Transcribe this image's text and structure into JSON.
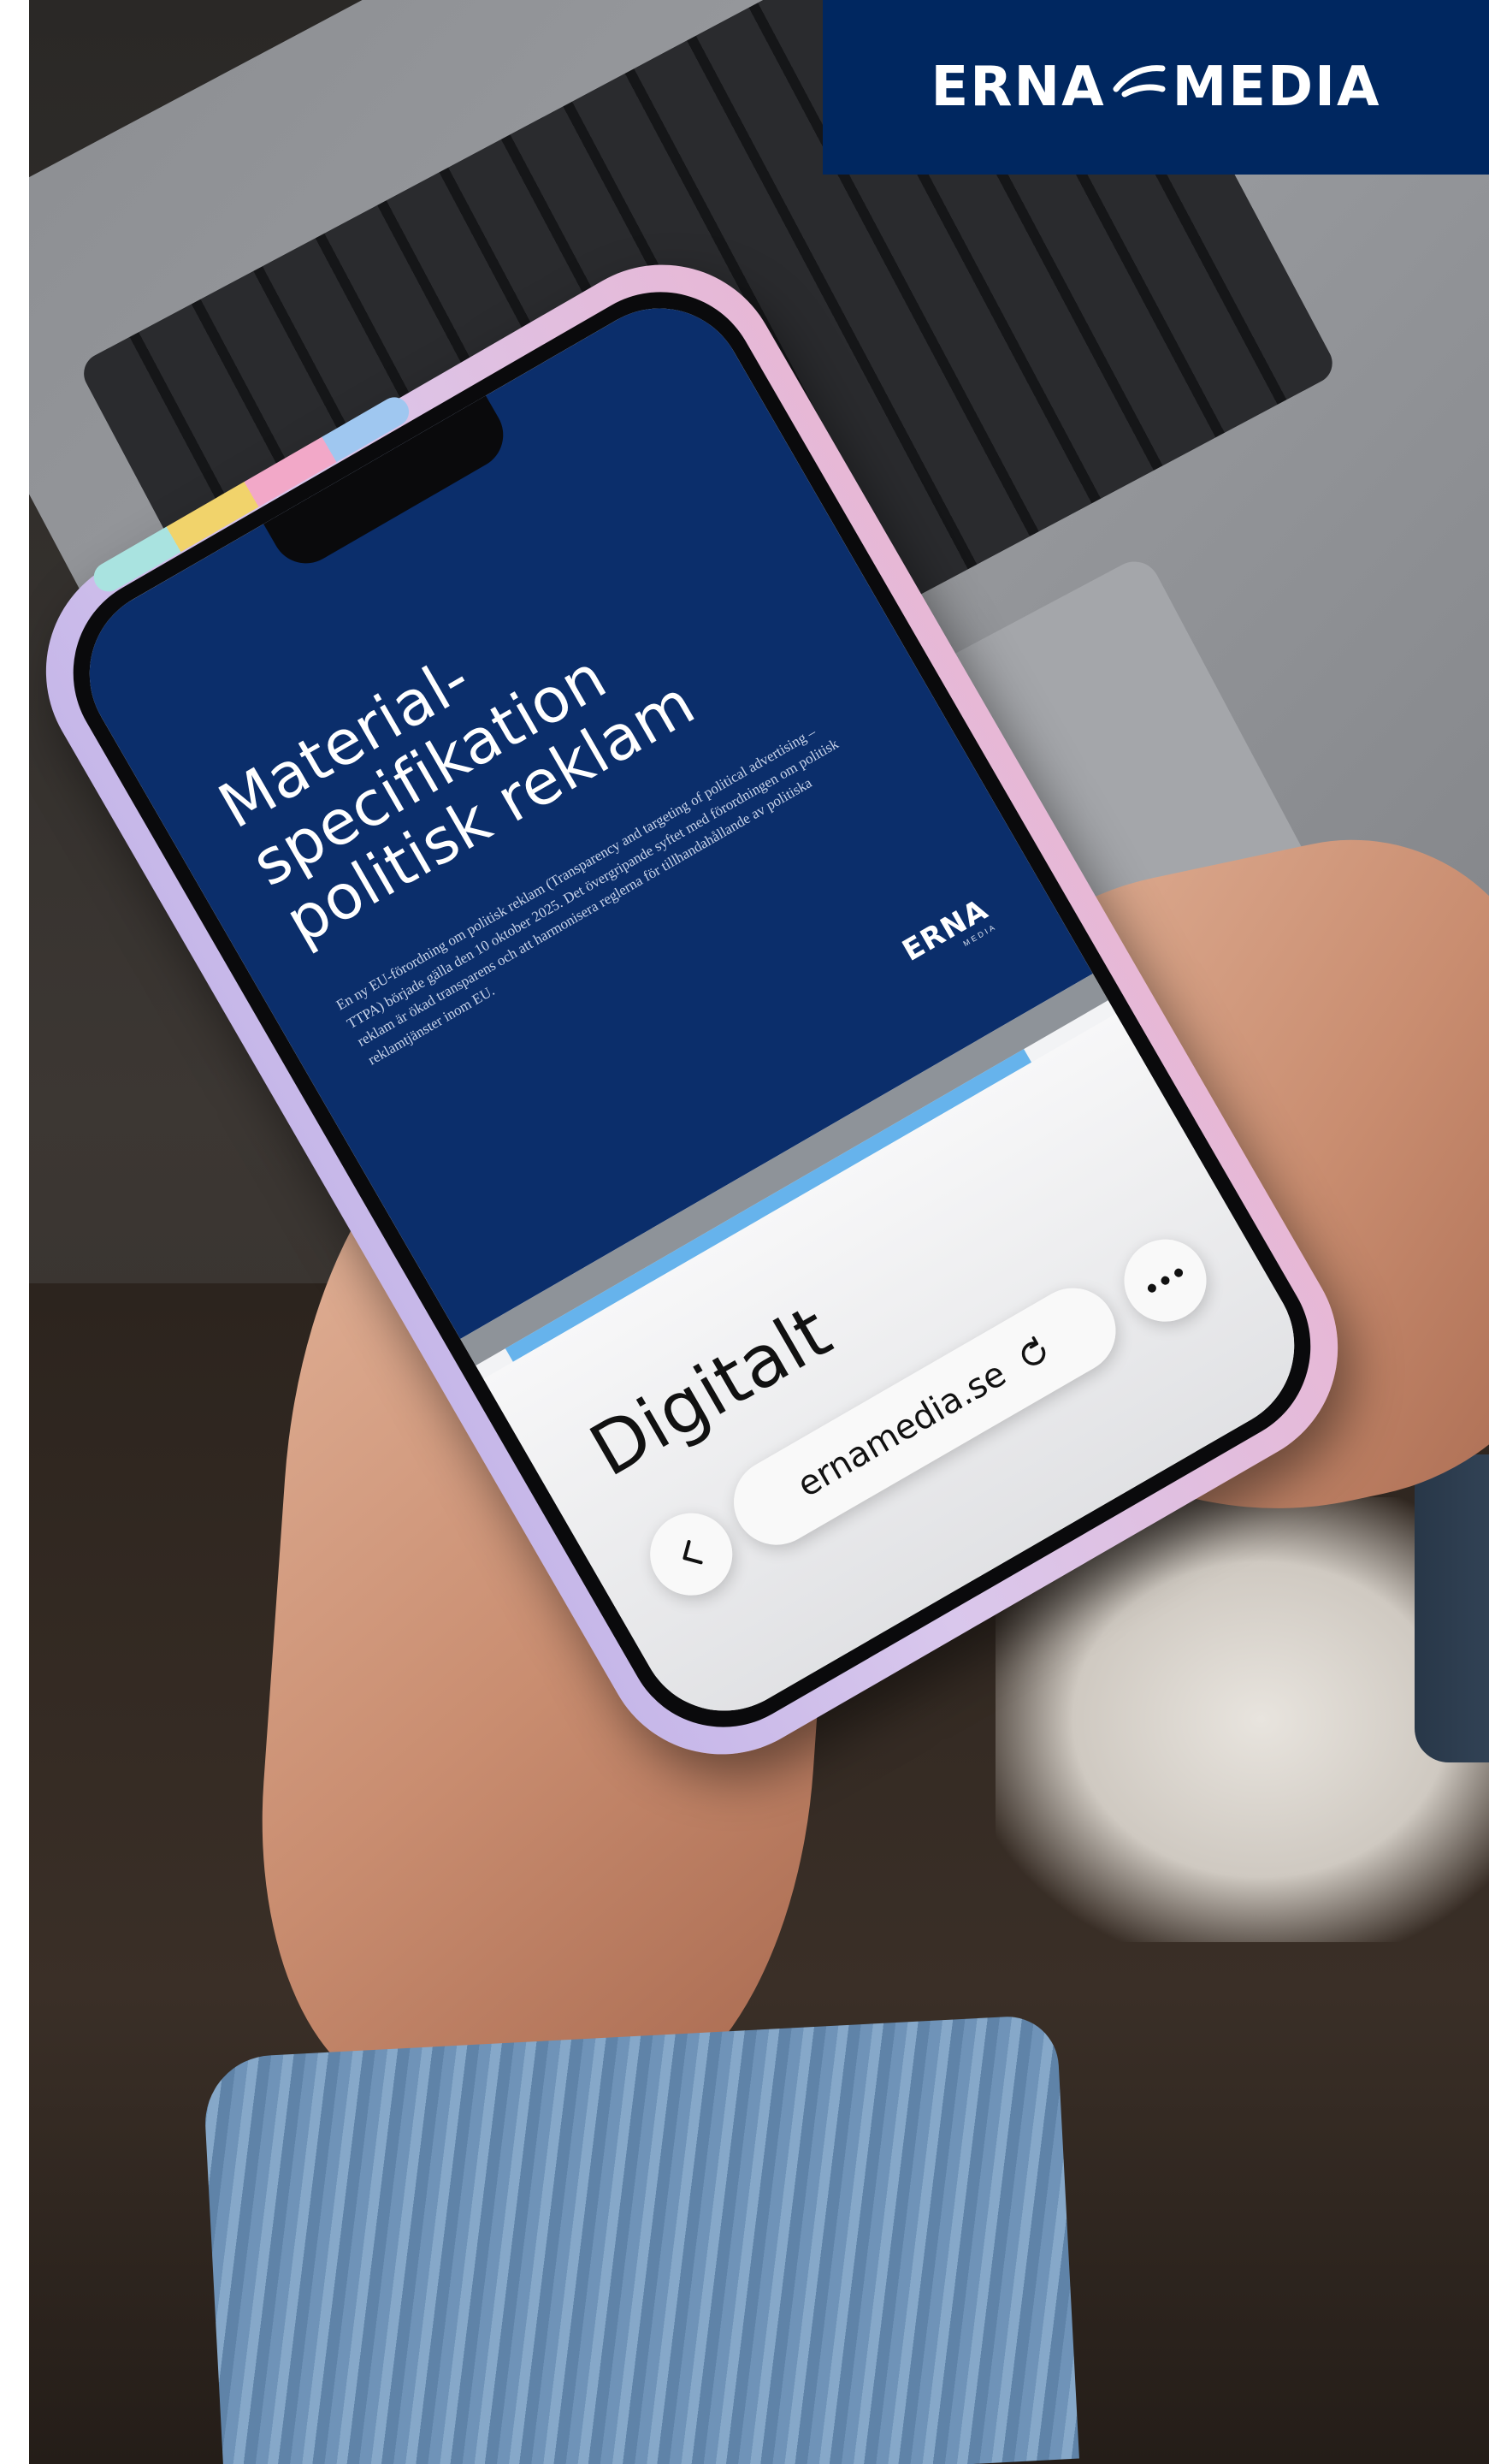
{
  "brand": {
    "left_word": "ERNA",
    "right_word": "MEDIA",
    "bar_color": "#002760"
  },
  "document": {
    "title": "Material-\nspecifikation\npolitisk reklam",
    "intro": "En ny EU-förordning om politisk reklam (Transparency and targeting of political advertising – TTPA) började gälla den 10 oktober 2025. Det övergripande syftet med förordningen om politisk reklam är ökad transparens och att harmonisera reglerna för tillhandahållande av politiska reklamtjänster inom EU.",
    "logo_word": "ERNA",
    "logo_sub": "MEDIA",
    "cover_color": "#0b2e6b",
    "accent_color": "#66b3ec",
    "section_heading": "Digitalt"
  },
  "browser": {
    "url": "ernamedia.se",
    "icons": [
      "back-chevron-icon",
      "reload-icon",
      "more-icon"
    ]
  }
}
